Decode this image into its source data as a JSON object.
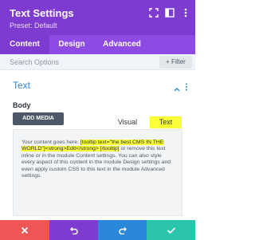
{
  "header": {
    "title": "Text Settings",
    "preset": "Preset: Default",
    "icons": [
      "expand-icon",
      "sidebar-icon",
      "more-icon"
    ]
  },
  "tabs": [
    {
      "label": "Content",
      "active": true
    },
    {
      "label": "Design",
      "active": false
    },
    {
      "label": "Advanced",
      "active": false
    }
  ],
  "search": {
    "placeholder": "Search Options",
    "filter_label": "+ Filter"
  },
  "section": {
    "title": "Text",
    "field_label": "Body",
    "add_media_label": "ADD MEDIA",
    "editor_tabs": [
      {
        "label": "Visual",
        "active": false
      },
      {
        "label": "Text",
        "active": true
      }
    ],
    "body_parts": [
      {
        "text": "Your content goes here. ",
        "highlight": false
      },
      {
        "text": "[tooltip text=\"the best CMS IN THE WORLD\"]<strong>Edit</strong> [/tooltip]",
        "highlight": true
      },
      {
        "text": " or remove this text inline or in the module Content settings. You can also style every aspect of this content in the module Design settings and even apply custom CSS to this text in the module Advanced settings.",
        "highlight": false
      }
    ]
  },
  "footer": {
    "buttons": [
      {
        "name": "discard",
        "color": "#ef5555"
      },
      {
        "name": "undo",
        "color": "#7e3bd0"
      },
      {
        "name": "redo",
        "color": "#2b87da"
      },
      {
        "name": "save",
        "color": "#29c4a9"
      }
    ]
  },
  "colors": {
    "header": "#7e3bd0",
    "tabs": "#8e4be3",
    "accent_blue": "#2b87da",
    "highlight": "#fbff3a"
  }
}
